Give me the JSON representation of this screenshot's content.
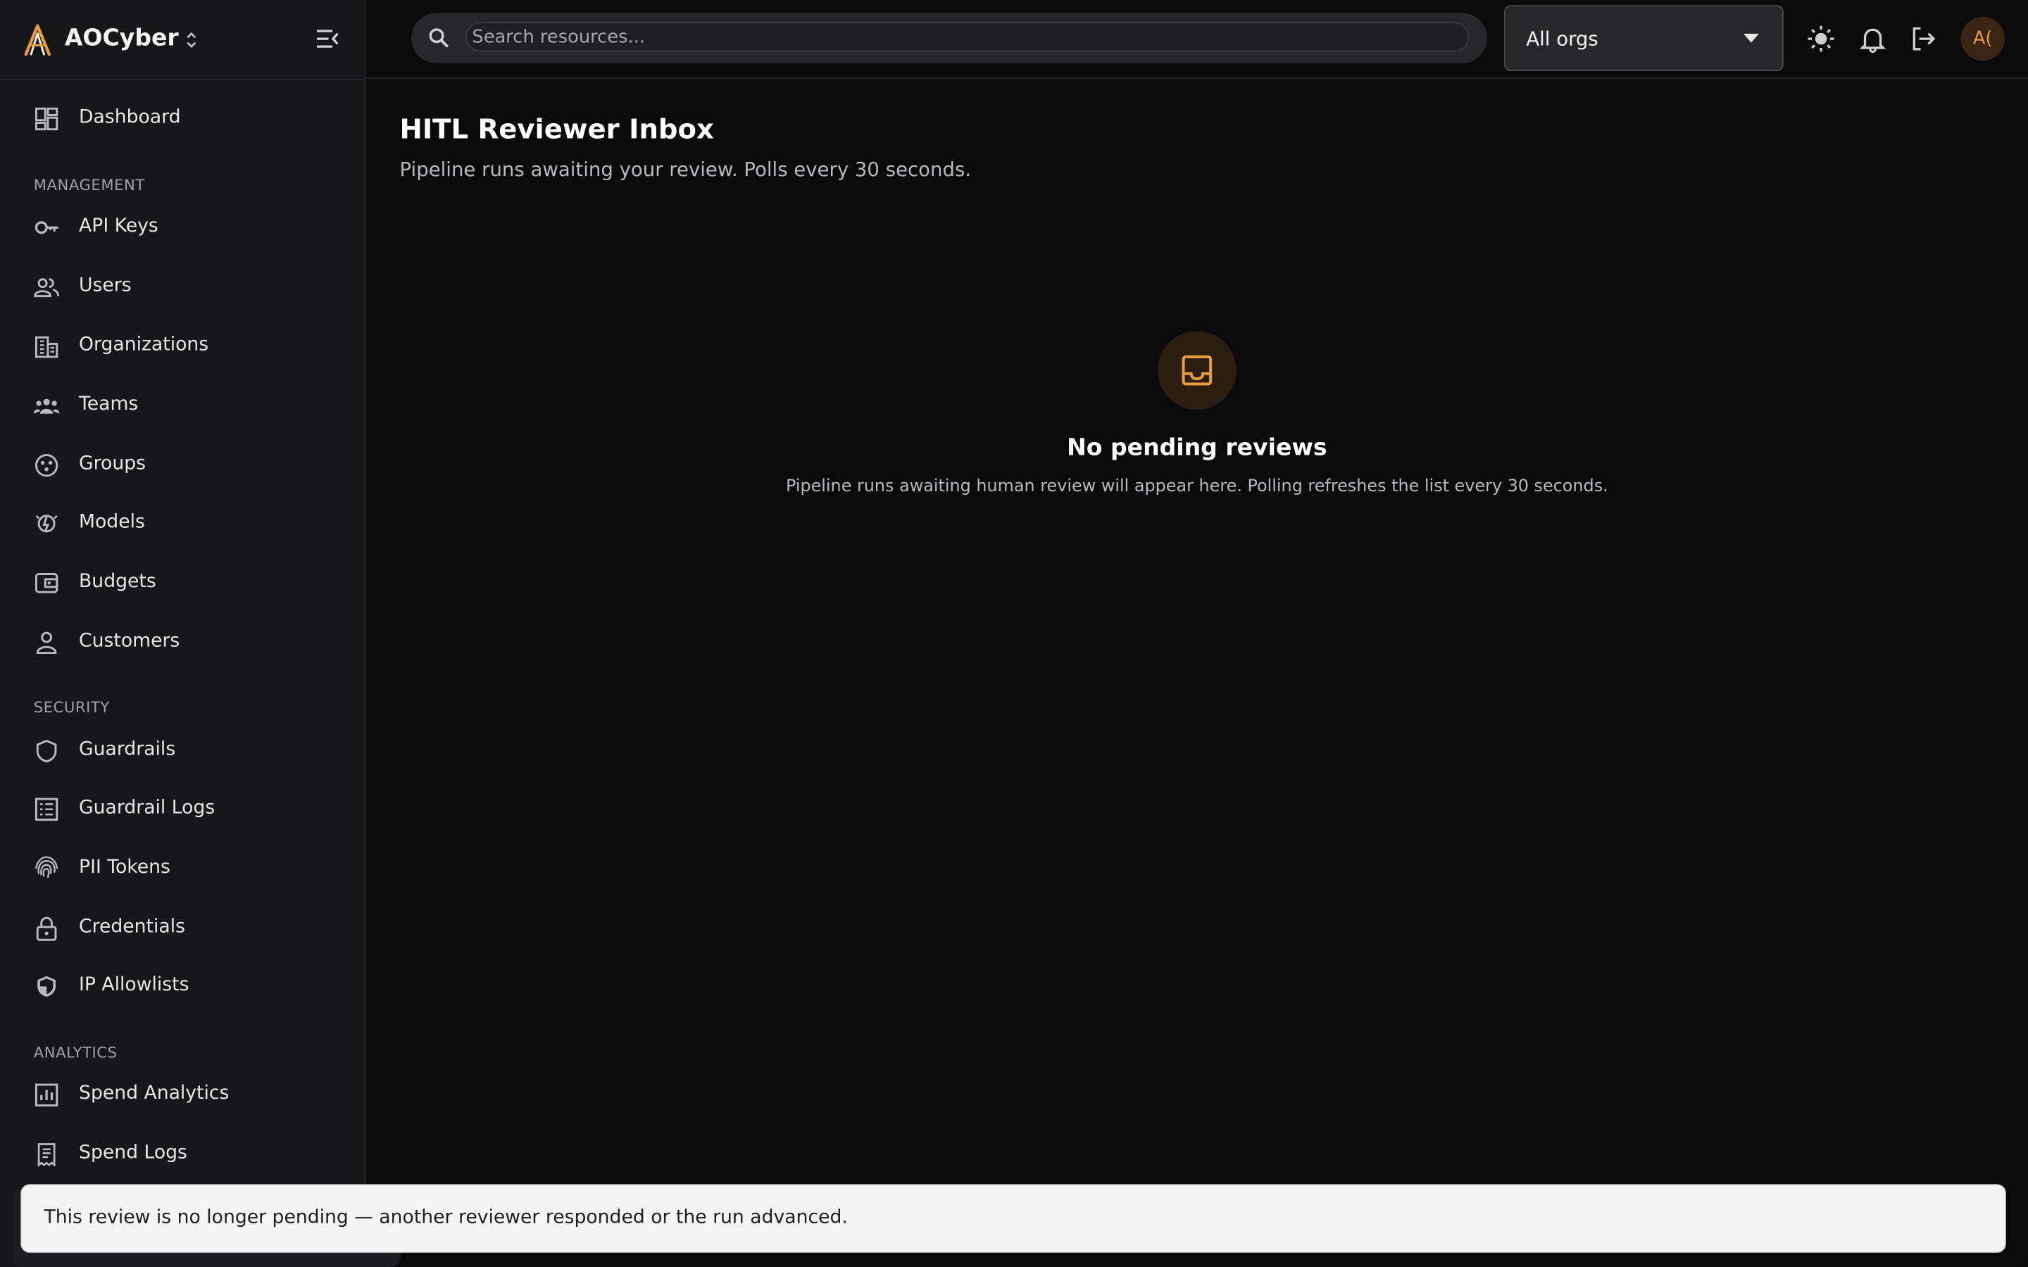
{
  "app": {
    "name": "AOCyber"
  },
  "sidebar": {
    "top_items": [
      {
        "label": "Dashboard",
        "icon": "dashboard-icon"
      }
    ],
    "sections": [
      {
        "title": "MANAGEMENT",
        "items": [
          {
            "label": "API Keys",
            "icon": "key-icon"
          },
          {
            "label": "Users",
            "icon": "users-icon"
          },
          {
            "label": "Organizations",
            "icon": "building-icon"
          },
          {
            "label": "Teams",
            "icon": "teams-icon"
          },
          {
            "label": "Groups",
            "icon": "groups-icon"
          },
          {
            "label": "Models",
            "icon": "models-icon"
          },
          {
            "label": "Budgets",
            "icon": "wallet-icon"
          },
          {
            "label": "Customers",
            "icon": "person-icon"
          }
        ]
      },
      {
        "title": "SECURITY",
        "items": [
          {
            "label": "Guardrails",
            "icon": "shield-icon"
          },
          {
            "label": "Guardrail Logs",
            "icon": "list-icon"
          },
          {
            "label": "PII Tokens",
            "icon": "fingerprint-icon"
          },
          {
            "label": "Credentials",
            "icon": "lock-icon"
          },
          {
            "label": "IP Allowlists",
            "icon": "shield-half-icon"
          }
        ]
      },
      {
        "title": "ANALYTICS",
        "items": [
          {
            "label": "Spend Analytics",
            "icon": "bar-chart-icon"
          },
          {
            "label": "Spend Logs",
            "icon": "receipt-icon"
          }
        ]
      }
    ]
  },
  "topbar": {
    "search_placeholder": "Search resources...",
    "org_selector": "All orgs",
    "avatar_initials": "A("
  },
  "main": {
    "title": "HITL Reviewer Inbox",
    "subtitle": "Pipeline runs awaiting your review. Polls every 30 seconds.",
    "empty_state": {
      "icon": "inbox-icon",
      "title": "No pending reviews",
      "description": "Pipeline runs awaiting human review will appear here. Polling refreshes the list every 30 seconds."
    }
  },
  "toast": {
    "message": "This review is no longer pending — another reviewer responded or the run advanced."
  },
  "colors": {
    "accent": "#e89a3c",
    "background": "#0a0a0a",
    "sidebar": "#171719"
  }
}
